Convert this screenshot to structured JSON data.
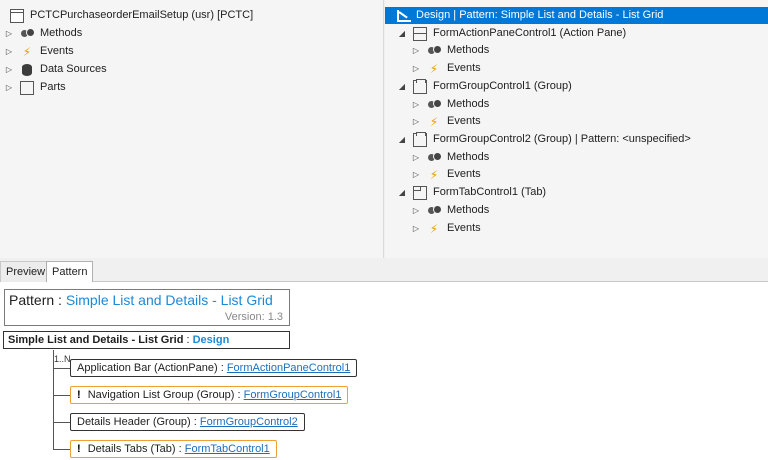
{
  "left_tree": {
    "root": "PCTCPurchaseorderEmailSetup (usr) [PCTC]",
    "items": [
      "Methods",
      "Events",
      "Data Sources",
      "Parts"
    ]
  },
  "right_tree": {
    "design": "Design | Pattern: Simple List and Details - List Grid",
    "nodes": [
      {
        "label": "FormActionPaneControl1 (Action Pane)",
        "children": [
          "Methods",
          "Events"
        ]
      },
      {
        "label": "FormGroupControl1 (Group)",
        "children": [
          "Methods",
          "Events"
        ]
      },
      {
        "label": "FormGroupControl2 (Group) | Pattern: <unspecified>",
        "children": [
          "Methods",
          "Events"
        ]
      },
      {
        "label": "FormTabControl1 (Tab)",
        "children": [
          "Methods",
          "Events"
        ]
      }
    ]
  },
  "tabs": {
    "preview": "Preview",
    "pattern": "Pattern"
  },
  "pattern": {
    "label": "Pattern",
    "separator": ":",
    "name": "Simple List and Details - List Grid",
    "version_label": "Version:",
    "version": "1.3",
    "root_name": "Simple List and Details - List Grid",
    "root_sep": ":",
    "root_target": "Design",
    "cardinality": "1..N",
    "children": [
      {
        "warn": false,
        "label": "Application Bar  (ActionPane)",
        "sep": ":",
        "link": "FormActionPaneControl1"
      },
      {
        "warn": true,
        "mark": "!",
        "label": "Navigation List Group  (Group)",
        "sep": ":",
        "link": "FormGroupControl1"
      },
      {
        "warn": false,
        "label": "Details Header  (Group)",
        "sep": ":",
        "link": "FormGroupControl2"
      },
      {
        "warn": true,
        "mark": "!",
        "label": "Details Tabs  (Tab)",
        "sep": ":",
        "link": "FormTabControl1"
      }
    ]
  },
  "colors": {
    "selection": "#0078d7",
    "link": "#1c6fbf",
    "accent": "#1c8ad6",
    "warning": "#f0a030"
  }
}
